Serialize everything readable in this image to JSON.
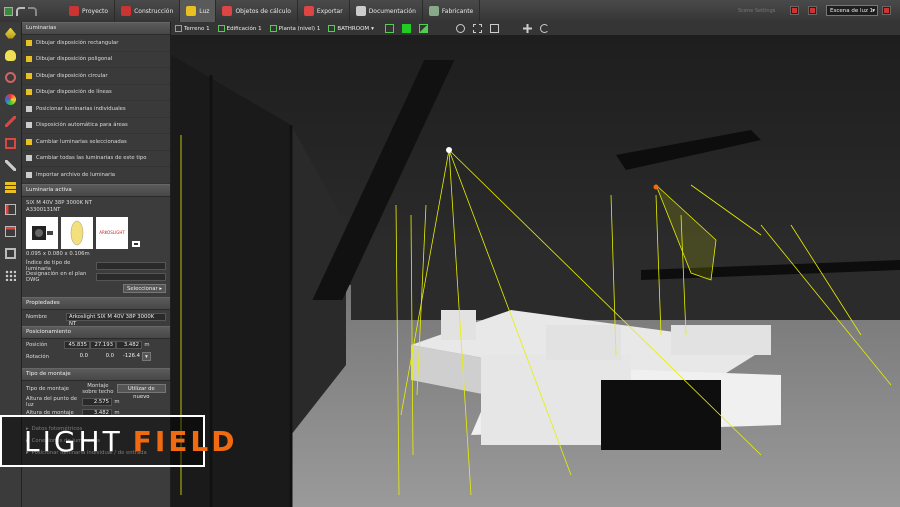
{
  "toolbar": {
    "menu": [
      {
        "label": "Proyecto",
        "icon": "project-icon"
      },
      {
        "label": "Construcción",
        "icon": "construction-icon"
      },
      {
        "label": "Luz",
        "icon": "light-icon"
      },
      {
        "label": "Objetos de cálculo",
        "icon": "calculation-objects-icon"
      },
      {
        "label": "Exportar",
        "icon": "export-icon"
      },
      {
        "label": "Documentación",
        "icon": "documentation-icon"
      },
      {
        "label": "Fabricante",
        "icon": "manufacturer-icon"
      }
    ],
    "active_menu": "Luz",
    "scene_select": "Escena de luz 1",
    "dim_label": "Scene Settings"
  },
  "viewbar": {
    "crumbs": [
      "Terreno 1",
      "Edificación 1",
      "Planta (nivel) 1",
      "BATHROOM"
    ]
  },
  "panel": {
    "header": "Luminarias",
    "items": [
      "Dibujar disposición rectangular",
      "Dibujar disposición poligonal",
      "Dibujar disposición circular",
      "Dibujar disposición de líneas",
      "Posicionar luminarias individuales",
      "Disposición automática para áreas",
      "Cambiar luminarias seleccionadas",
      "Cambiar todas las luminarias de este tipo",
      "Importar archivo de luminaria"
    ],
    "active_header": "Luminaria activa",
    "luminaire_name": "SIX M 40V 38P 3000K NT",
    "luminaire_code": "A3300131NT",
    "brand_thumb": "ARKOSLIGHT",
    "dimensions": "0.095 x 0.080 x 0.106m",
    "type_index_label": "Índice de tipo de luminaria",
    "dwg_label": "Designación en el plan DWG",
    "select_button": "Seleccionar",
    "props_header": "Propiedades",
    "name_label": "Nombre",
    "name_value": "Arkoslight SIX M 40V 38P 3000K NT",
    "pos_header": "Posicionamiento",
    "position_label": "Posición",
    "position_values": [
      "45.835",
      "27.193",
      "3.482"
    ],
    "position_unit": "m",
    "rotation_label": "Rotación",
    "rotation_values": [
      "0.0",
      "0.0",
      "-126.4"
    ],
    "mount_header": "Tipo de montaje",
    "mount_type_label": "Tipo de montaje",
    "mount_type_value": "Montaje sobre techo",
    "reuse_button": "Utilizar de nuevo",
    "point_height_label": "Altura del punto de luz",
    "point_height_value": "2.575",
    "mount_height_label": "Altura de montaje",
    "mount_height_value": "3.482",
    "collapsed": [
      "Datos fotométricos",
      "Conexiones de luminarias",
      "Posicionar luminaria individual / de entrada"
    ]
  },
  "logo": {
    "part1": "LIGHT",
    "part2": "FIELD"
  },
  "colors": {
    "accent": "#f06a12",
    "ray": "#e8f000",
    "panel_bg": "#3c3c3c"
  }
}
